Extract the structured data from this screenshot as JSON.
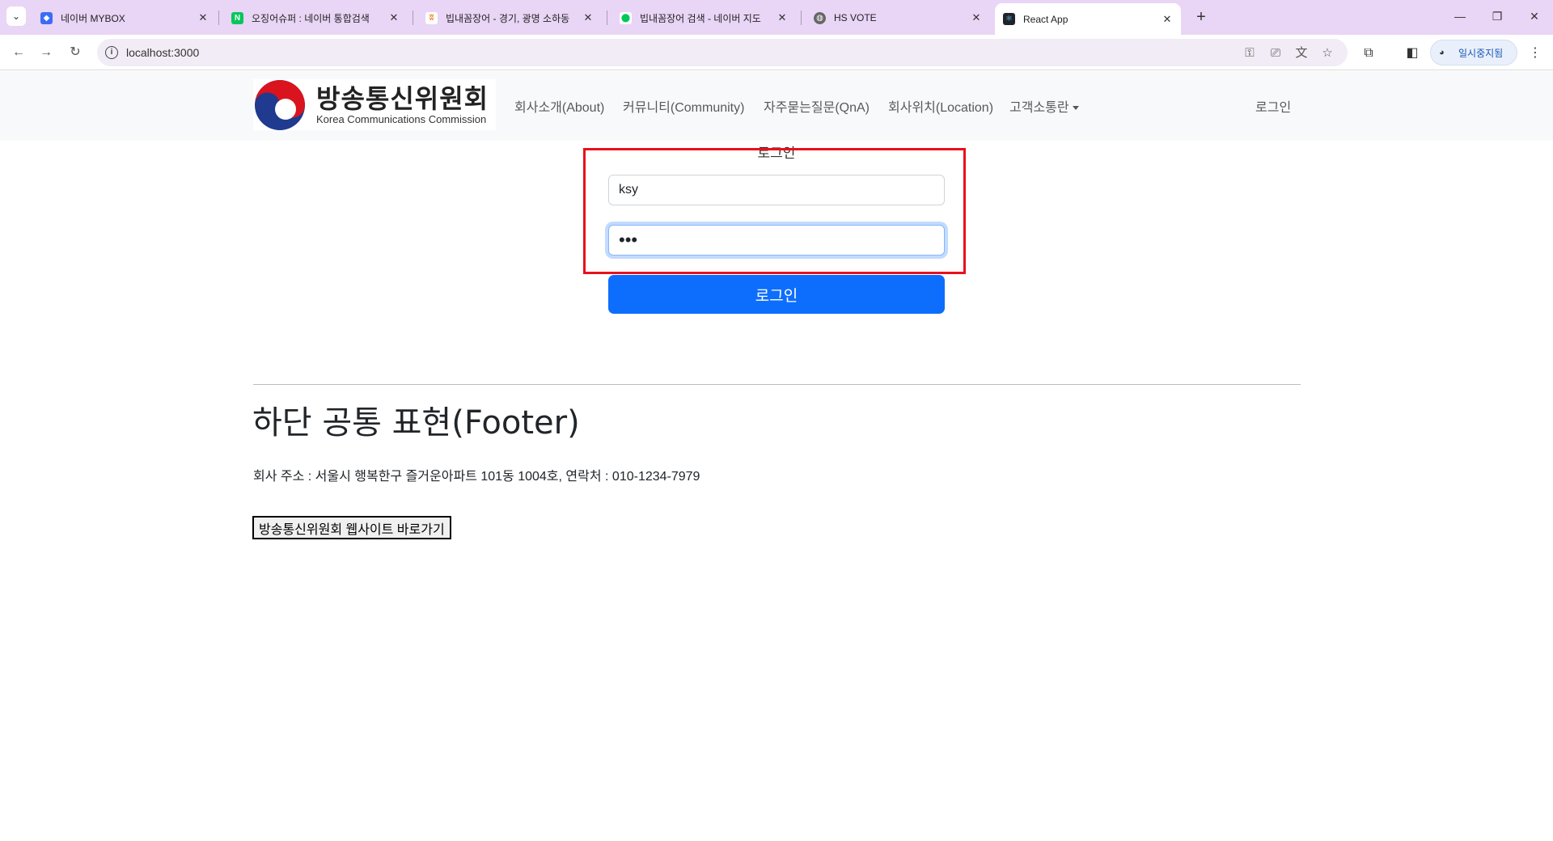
{
  "browser": {
    "tabs": [
      {
        "title": "네이버 MYBOX",
        "favicon": "mybox-icon",
        "color": "#3b6cf6"
      },
      {
        "title": "오징어슈퍼 : 네이버 통합검색",
        "favicon": "naver-icon",
        "color": "#03c75a"
      },
      {
        "title": "빕내꼼장어 - 경기, 광명 소하동",
        "favicon": "restaurant-icon",
        "color": "#f27a1a"
      },
      {
        "title": "빕내꼼장어 검색 - 네이버 지도",
        "favicon": "naver-map-icon",
        "color": "#03c75a"
      },
      {
        "title": "HS VOTE",
        "favicon": "globe-icon",
        "color": "#666666"
      },
      {
        "title": "React App",
        "favicon": "react-icon",
        "color": "#20232a"
      }
    ],
    "url": "localhost:3000",
    "profile_label": "일시중지됨"
  },
  "navbar": {
    "logo_ko": "방송통신위원회",
    "logo_en": "Korea Communications Commission",
    "links": [
      "회사소개(About)",
      "커뮤니티(Community)",
      "자주묻는질문(QnA)",
      "회사위치(Location)",
      "고객소통란"
    ],
    "login_link": "로그인"
  },
  "login": {
    "title": "로그인",
    "username_value": "ksy",
    "password_mask": "•••",
    "submit_label": "로그인"
  },
  "footer": {
    "title": "하단 공통 표현(Footer)",
    "address": "회사 주소 : 서울시 행복한구 즐거운아파트 101동 1004호, 연락처 : 010-1234-7979",
    "button_label": "방송통신위원회 웹사이트 바로가기"
  },
  "colors": {
    "primary": "#0d6efd",
    "highlight_box": "#e8111b",
    "tabbar": "#e9d5f5"
  }
}
